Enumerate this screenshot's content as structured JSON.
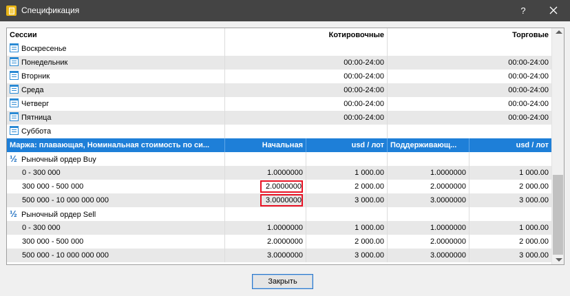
{
  "window": {
    "title": "Спецификация",
    "help_label": "?"
  },
  "sessions": {
    "headers": [
      "Сессии",
      "Котировочные",
      "Торговые"
    ],
    "rows": [
      {
        "day": "Воскресенье",
        "quote": "",
        "trade": ""
      },
      {
        "day": "Понедельник",
        "quote": "00:00-24:00",
        "trade": "00:00-24:00"
      },
      {
        "day": "Вторник",
        "quote": "00:00-24:00",
        "trade": "00:00-24:00"
      },
      {
        "day": "Среда",
        "quote": "00:00-24:00",
        "trade": "00:00-24:00"
      },
      {
        "day": "Четверг",
        "quote": "00:00-24:00",
        "trade": "00:00-24:00"
      },
      {
        "day": "Пятница",
        "quote": "00:00-24:00",
        "trade": "00:00-24:00"
      },
      {
        "day": "Суббота",
        "quote": "",
        "trade": ""
      }
    ]
  },
  "margin": {
    "headers": [
      "Маржа: плавающая, Номинальная стоимость по си...",
      "Начальная",
      "usd / лот",
      "Поддерживающ...",
      "usd / лот"
    ],
    "groups": [
      {
        "label": "Рыночный ордер Buy",
        "rows": [
          {
            "range": "0 - 300 000",
            "initial": "1.0000000",
            "initial_usd": "1 000.00",
            "maint": "1.0000000",
            "maint_usd": "1 000.00"
          },
          {
            "range": "300 000 - 500 000",
            "initial": "2.0000000",
            "initial_usd": "2 000.00",
            "maint": "2.0000000",
            "maint_usd": "2 000.00"
          },
          {
            "range": "500 000 - 10 000 000 000",
            "initial": "3.0000000",
            "initial_usd": "3 000.00",
            "maint": "3.0000000",
            "maint_usd": "3 000.00"
          }
        ]
      },
      {
        "label": "Рыночный ордер Sell",
        "rows": [
          {
            "range": "0 - 300 000",
            "initial": "1.0000000",
            "initial_usd": "1 000.00",
            "maint": "1.0000000",
            "maint_usd": "1 000.00"
          },
          {
            "range": "300 000 - 500 000",
            "initial": "2.0000000",
            "initial_usd": "2 000.00",
            "maint": "2.0000000",
            "maint_usd": "2 000.00"
          },
          {
            "range": "500 000 - 10 000 000 000",
            "initial": "3.0000000",
            "initial_usd": "3 000.00",
            "maint": "3.0000000",
            "maint_usd": "3 000.00"
          }
        ]
      }
    ]
  },
  "group_icon": "½",
  "buttons": {
    "close": "Закрыть"
  },
  "colors": {
    "header_blue": "#1e7fd8",
    "highlight_red": "#e81123",
    "titlebar": "#444444"
  }
}
